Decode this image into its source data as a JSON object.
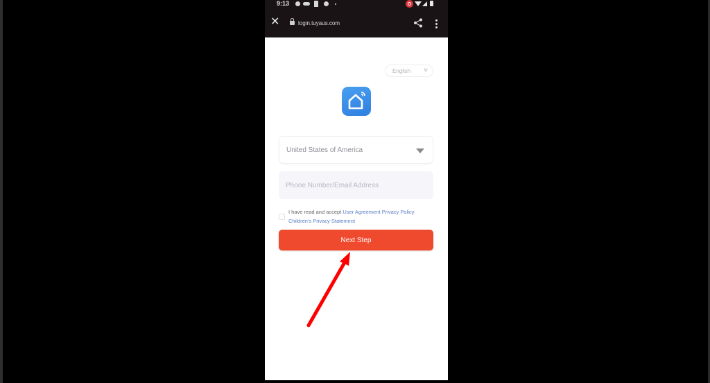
{
  "status_bar": {
    "time": "9:13",
    "icons": [
      "gps-icon",
      "voicemail-icon",
      "sim-icon",
      "gps-icon",
      "dot-icon",
      "screen-record-icon",
      "wifi-icon",
      "signal-icon",
      "battery-icon"
    ]
  },
  "browser": {
    "url": "login.tuyaus.com",
    "close_icon": "close-icon",
    "lock_icon": "lock-icon",
    "share_icon": "share-icon",
    "menu_icon": "kebab-menu-icon"
  },
  "login": {
    "language": "English",
    "logo_icon": "smart-home-icon",
    "country": "United States of America",
    "account_placeholder": "Phone Number/Email Address",
    "account_value": "",
    "agreement_prefix": "I have read and accept",
    "links": {
      "user_agreement": "User Agreement",
      "privacy_policy": "Privacy Policy",
      "children_privacy": "Children's Privacy Statement"
    },
    "agreement_checked": false,
    "next_button": "Next Step"
  },
  "annotation": {
    "type": "arrow",
    "color": "#ff0000",
    "points_to": "Next Step"
  },
  "colors": {
    "primary_button": "#f04a2e",
    "link": "#5b7fc6",
    "logo_blue": "#3a8ee8"
  }
}
